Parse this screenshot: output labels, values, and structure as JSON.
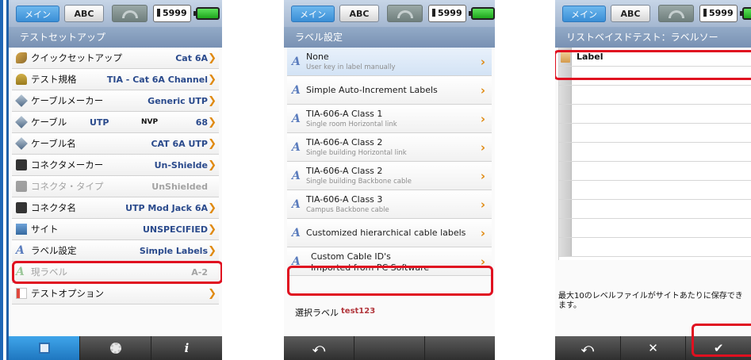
{
  "panel1": {
    "status": {
      "mode": "メイン",
      "abc": "ABC",
      "count": "5999"
    },
    "title": "テストセットアップ",
    "rows": [
      {
        "label": "クイックセットアップ",
        "value": "Cat 6A",
        "icon": "wrench-icon"
      },
      {
        "label": "テスト規格",
        "value": "TIA - Cat 6A Channel",
        "icon": "key-icon"
      },
      {
        "label": "ケーブルメーカー",
        "value": "Generic UTP",
        "icon": "cable-icon"
      },
      {
        "label": "ケーブル",
        "value_a": "UTP",
        "value_b": "NVP",
        "value": "68",
        "icon": "cable-icon"
      },
      {
        "label": "ケーブル名",
        "value": "CAT 6A UTP",
        "icon": "cable-icon"
      },
      {
        "label": "コネクタメーカー",
        "value": "Un-Shielde",
        "icon": "connector-icon"
      },
      {
        "label": "コネクタ・タイプ",
        "value": "UnShielded",
        "icon": "connector-icon"
      },
      {
        "label": "コネクタ名",
        "value": "UTP Mod Jack 6A",
        "icon": "connector-icon"
      },
      {
        "label": "サイト",
        "value": "UNSPECIFIED",
        "icon": "site-icon"
      },
      {
        "label": "ラベル設定",
        "value": "Simple Labels",
        "icon": "label-a-icon"
      },
      {
        "label": "現ラベル",
        "value": "A-2",
        "icon": "label-a-icon"
      },
      {
        "label": "テストオプション",
        "value": "",
        "icon": "flag-icon"
      }
    ],
    "info_glyph": "i"
  },
  "panel2": {
    "status": {
      "mode": "メイン",
      "abc": "ABC",
      "count": "5999"
    },
    "title": "ラベル設定",
    "rows": [
      {
        "title": "None",
        "subtitle": "User key in label manually"
      },
      {
        "title": "Simple Auto-Increment Labels",
        "subtitle": ""
      },
      {
        "title": "TIA-606-A Class 1",
        "subtitle": "Single room Horizontal link"
      },
      {
        "title": "TIA-606-A Class 2",
        "subtitle": "Single building Horizontal link"
      },
      {
        "title": "TIA-606-A Class 2",
        "subtitle": "Single building Backbone cable"
      },
      {
        "title": "TIA-606-A Class 3",
        "subtitle": "Campus Backbone cable"
      },
      {
        "title": "Customized hierarchical cable labels",
        "subtitle": ""
      },
      {
        "title": "Custom Cable ID's",
        "subtitle": "Imported from PC Software"
      }
    ],
    "selected_label_key": "選択ラベル",
    "selected_label_value": "test123"
  },
  "panel3": {
    "status": {
      "mode": "メイン",
      "abc": "ABC",
      "count": "5999"
    },
    "title": "リストベイスドテスト：ラベルソー",
    "rows": [
      "Label",
      "",
      "",
      "",
      "",
      "",
      "",
      "",
      "",
      "",
      ""
    ],
    "note": "最大10のレベルファイルがサイトあたりに保存できます。"
  },
  "colors": {
    "highlight": "#e01020",
    "accent_blue": "#1f77c0",
    "chevron": "#e08a12"
  }
}
